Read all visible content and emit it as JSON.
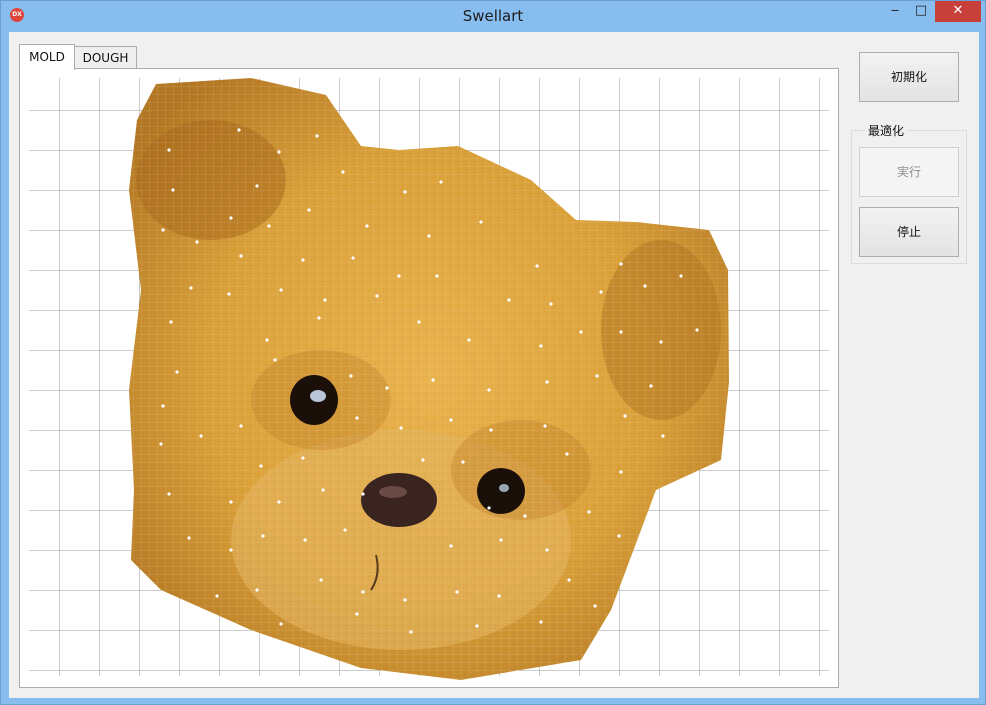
{
  "window": {
    "title": "Swellart",
    "app_icon_text": "DX",
    "controls": {
      "minimize": "‒",
      "maximize": "□",
      "close": "✕"
    }
  },
  "tabs": [
    {
      "label": "MOLD",
      "selected": true
    },
    {
      "label": "DOUGH",
      "selected": false
    }
  ],
  "buttons": {
    "init": "初期化",
    "run": "実行",
    "stop": "停止"
  },
  "group": {
    "label": "最適化"
  },
  "colors": {
    "titlebar": "#88bdf0",
    "close": "#c7413a",
    "fur_light": "#e6b04a",
    "fur_dark": "#8a5416"
  }
}
